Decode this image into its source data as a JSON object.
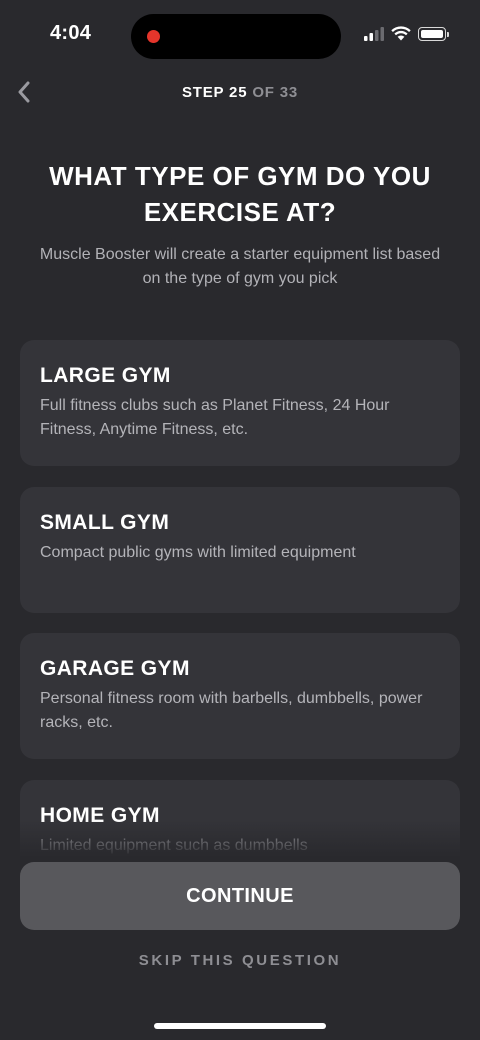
{
  "status_bar": {
    "time": "4:04",
    "icons": [
      "cellular-signal-icon",
      "wifi-icon",
      "battery-icon"
    ],
    "recording_indicator_color": "#e5352b"
  },
  "header": {
    "back_icon": "chevron-left-icon",
    "step_label": "STEP",
    "step_current": "25",
    "step_of": "OF",
    "step_total": "33"
  },
  "question": {
    "title": "WHAT TYPE OF GYM DO YOU EXERCISE AT?",
    "subtitle": "Muscle Booster will create a starter equipment list based on the type of gym you pick"
  },
  "options": [
    {
      "title": "LARGE GYM",
      "description": "Full fitness clubs such as Planet Fitness, 24 Hour Fitness, Anytime Fitness, etc."
    },
    {
      "title": "SMALL GYM",
      "description": "Compact public gyms with limited equipment"
    },
    {
      "title": "GARAGE GYM",
      "description": "Personal fitness room with barbells, dumbbells, power racks, etc."
    },
    {
      "title": "HOME GYM",
      "description": "Limited equipment such as dumbbells"
    }
  ],
  "actions": {
    "continue_label": "CONTINUE",
    "skip_label": "SKIP THIS QUESTION"
  },
  "colors": {
    "background": "#29292d",
    "card": "#343439",
    "continue_button": "#58585c",
    "muted_text": "#8e8e93"
  }
}
